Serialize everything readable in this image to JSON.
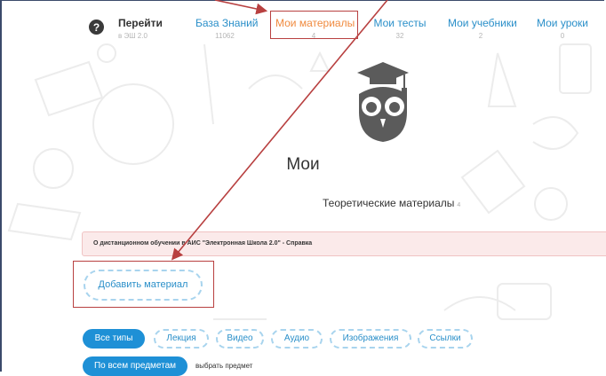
{
  "nav": {
    "help_symbol": "?",
    "items": [
      {
        "label": "Перейти",
        "sub": "в ЭШ 2.0"
      },
      {
        "label": "База Знаний",
        "sub": "11062"
      },
      {
        "label": "Мои материалы",
        "sub": "4"
      },
      {
        "label": "Мои тесты",
        "sub": "32"
      },
      {
        "label": "Мои учебники",
        "sub": "2"
      },
      {
        "label": "Мои уроки",
        "sub": "0"
      }
    ]
  },
  "page": {
    "title": "Мои",
    "subtitle": "Теоретические материалы",
    "subtitle_count": "4"
  },
  "alert": {
    "text": "О дистанционном обучении в АИС \"Электронная Школа 2.0\" - Справка"
  },
  "add_button": "Добавить материал",
  "filters": {
    "types": [
      "Все типы",
      "Лекция",
      "Видео",
      "Аудио",
      "Изображения",
      "Ссылки"
    ],
    "subjects_button": "По всем предметам",
    "subject_hint": "выбрать предмет"
  },
  "colors": {
    "accent": "#1e90d6",
    "active_nav": "#f08a3e",
    "annotation": "#b84040",
    "alert_bg": "#fbeaea"
  }
}
